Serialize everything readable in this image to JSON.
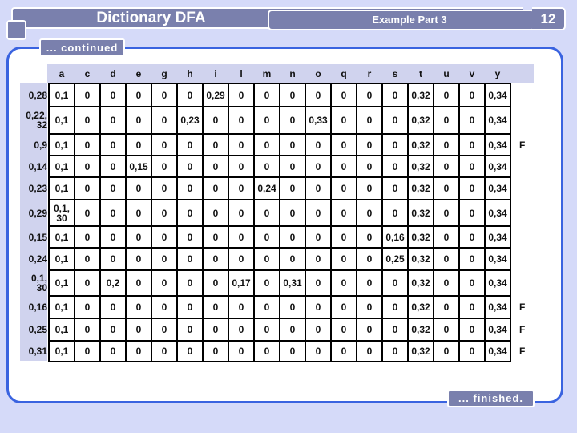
{
  "header": {
    "title": "Dictionary DFA",
    "part_label": "Example Part 3",
    "page_number": "12"
  },
  "labels": {
    "continued": "... continued",
    "finished": "... finished."
  },
  "colors": {
    "background": "#d5daf9",
    "tab_fill": "#7a80ad",
    "panel_border": "#3a63e0",
    "header_fill": "#d0d3ee"
  },
  "table": {
    "columns": [
      "a",
      "c",
      "d",
      "e",
      "g",
      "h",
      "i",
      "l",
      "m",
      "n",
      "o",
      "q",
      "r",
      "s",
      "t",
      "u",
      "v",
      "y"
    ],
    "rows": [
      {
        "state": "0,28",
        "final": "",
        "cells": [
          "0,1",
          "0",
          "0",
          "0",
          "0",
          "0",
          "0,29",
          "0",
          "0",
          "0",
          "0",
          "0",
          "0",
          "0",
          "0,32",
          "0",
          "0",
          "0,34"
        ]
      },
      {
        "state": "0,22, 32",
        "final": "",
        "cells": [
          "0,1",
          "0",
          "0",
          "0",
          "0",
          "0,23",
          "0",
          "0",
          "0",
          "0",
          "0,33",
          "0",
          "0",
          "0",
          "0,32",
          "0",
          "0",
          "0,34"
        ]
      },
      {
        "state": "0,9",
        "final": "F",
        "cells": [
          "0,1",
          "0",
          "0",
          "0",
          "0",
          "0",
          "0",
          "0",
          "0",
          "0",
          "0",
          "0",
          "0",
          "0",
          "0,32",
          "0",
          "0",
          "0,34"
        ]
      },
      {
        "state": "0,14",
        "final": "",
        "cells": [
          "0,1",
          "0",
          "0",
          "0,15",
          "0",
          "0",
          "0",
          "0",
          "0",
          "0",
          "0",
          "0",
          "0",
          "0",
          "0,32",
          "0",
          "0",
          "0,34"
        ]
      },
      {
        "state": "0,23",
        "final": "",
        "cells": [
          "0,1",
          "0",
          "0",
          "0",
          "0",
          "0",
          "0",
          "0",
          "0,24",
          "0",
          "0",
          "0",
          "0",
          "0",
          "0,32",
          "0",
          "0",
          "0,34"
        ]
      },
      {
        "state": "0,29",
        "final": "",
        "cells": [
          "0,1, 30",
          "0",
          "0",
          "0",
          "0",
          "0",
          "0",
          "0",
          "0",
          "0",
          "0",
          "0",
          "0",
          "0",
          "0,32",
          "0",
          "0",
          "0,34"
        ]
      },
      {
        "state": "0,15",
        "final": "",
        "cells": [
          "0,1",
          "0",
          "0",
          "0",
          "0",
          "0",
          "0",
          "0",
          "0",
          "0",
          "0",
          "0",
          "0",
          "0,16",
          "0,32",
          "0",
          "0",
          "0,34"
        ]
      },
      {
        "state": "0,24",
        "final": "",
        "cells": [
          "0,1",
          "0",
          "0",
          "0",
          "0",
          "0",
          "0",
          "0",
          "0",
          "0",
          "0",
          "0",
          "0",
          "0,25",
          "0,32",
          "0",
          "0",
          "0,34"
        ]
      },
      {
        "state": "0,1, 30",
        "final": "",
        "cells": [
          "0,1",
          "0",
          "0,2",
          "0",
          "0",
          "0",
          "0",
          "0,17",
          "0",
          "0,31",
          "0",
          "0",
          "0",
          "0",
          "0,32",
          "0",
          "0",
          "0,34"
        ]
      },
      {
        "state": "0,16",
        "final": "F",
        "cells": [
          "0,1",
          "0",
          "0",
          "0",
          "0",
          "0",
          "0",
          "0",
          "0",
          "0",
          "0",
          "0",
          "0",
          "0",
          "0,32",
          "0",
          "0",
          "0,34"
        ]
      },
      {
        "state": "0,25",
        "final": "F",
        "cells": [
          "0,1",
          "0",
          "0",
          "0",
          "0",
          "0",
          "0",
          "0",
          "0",
          "0",
          "0",
          "0",
          "0",
          "0",
          "0,32",
          "0",
          "0",
          "0,34"
        ]
      },
      {
        "state": "0,31",
        "final": "F",
        "cells": [
          "0,1",
          "0",
          "0",
          "0",
          "0",
          "0",
          "0",
          "0",
          "0",
          "0",
          "0",
          "0",
          "0",
          "0",
          "0,32",
          "0",
          "0",
          "0,34"
        ]
      }
    ]
  }
}
